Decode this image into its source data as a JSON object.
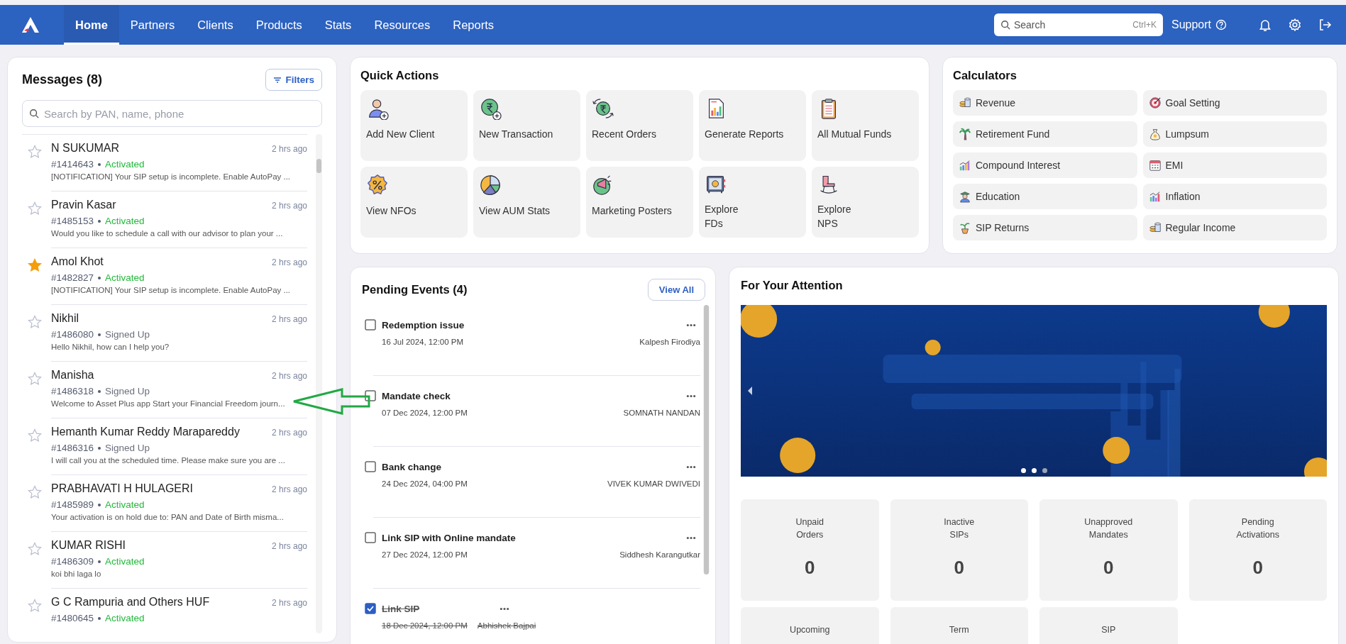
{
  "nav": {
    "tabs": [
      {
        "label": "Home",
        "selected": true
      },
      {
        "label": "Partners",
        "selected": false
      },
      {
        "label": "Clients",
        "selected": false
      },
      {
        "label": "Products",
        "selected": false
      },
      {
        "label": "Stats",
        "selected": false
      },
      {
        "label": "Resources",
        "selected": false
      },
      {
        "label": "Reports",
        "selected": false
      }
    ],
    "search": {
      "placeholder": "Search",
      "shortcut": "Ctrl+K"
    },
    "support": "Support"
  },
  "messages": {
    "title": "Messages (8)",
    "filters": "Filters",
    "search_placeholder": "Search by PAN, name, phone",
    "items": [
      {
        "name": "N SUKUMAR",
        "id": "#1414643",
        "status": {
          "text": "Activated",
          "color": "#22b83a"
        },
        "time": "2 hrs ago",
        "preview": "[NOTIFICATION] Your SIP setup is incomplete. Enable AutoPay ...",
        "starred": false
      },
      {
        "name": "Pravin Kasar",
        "id": "#1485153",
        "status": {
          "text": "Activated",
          "color": "#22b83a"
        },
        "time": "2 hrs ago",
        "preview": "Would you like to schedule a call with our advisor to plan your ...",
        "starred": false
      },
      {
        "name": "Amol Khot",
        "id": "#1482827",
        "status": {
          "text": "Activated",
          "color": "#22b83a"
        },
        "time": "2 hrs ago",
        "preview": "[NOTIFICATION] Your SIP setup is incomplete. Enable AutoPay ...",
        "starred": true
      },
      {
        "name": "Nikhil",
        "id": "#1486080",
        "status": {
          "text": "Signed Up",
          "color": "#6b6f7a"
        },
        "time": "2 hrs ago",
        "preview": "Hello Nikhil, how can I help you?",
        "starred": false
      },
      {
        "name": "Manisha",
        "id": "#1486318",
        "status": {
          "text": "Signed Up",
          "color": "#6b6f7a"
        },
        "time": "2 hrs ago",
        "preview": "Welcome to Asset Plus app Start your Financial Freedom journ...",
        "starred": false
      },
      {
        "name": "Hemanth Kumar Reddy Marapareddy",
        "id": "#1486316",
        "status": {
          "text": "Signed Up",
          "color": "#6b6f7a"
        },
        "time": "2 hrs ago",
        "preview": "I will call you at the scheduled time. Please make sure you are ...",
        "starred": false
      },
      {
        "name": "PRABHAVATI H HULAGERI",
        "id": "#1485989",
        "status": {
          "text": "Activated",
          "color": "#22b83a"
        },
        "time": "2 hrs ago",
        "preview": "Your activation is on hold due to: PAN and Date of Birth misma...",
        "starred": false
      },
      {
        "name": "KUMAR RISHI",
        "id": "#1486309",
        "status": {
          "text": "Activated",
          "color": "#22b83a"
        },
        "time": "2 hrs ago",
        "preview": "koi bhi laga lo",
        "starred": false
      },
      {
        "name": "G C Rampuria and Others HUF",
        "id": "#1480645",
        "status": {
          "text": "Activated",
          "color": "#22b83a"
        },
        "time": "2 hrs ago",
        "starred": false
      }
    ]
  },
  "quick_actions": {
    "title": "Quick Actions",
    "items": [
      {
        "label_lines": [
          "Add New Client"
        ]
      },
      {
        "label_lines": [
          "New Transaction"
        ]
      },
      {
        "label_lines": [
          "Recent Orders"
        ]
      },
      {
        "label_lines": [
          "Generate Reports"
        ]
      },
      {
        "label_lines": [
          "All Mutual Funds"
        ]
      },
      {
        "label_lines": [
          "View NFOs"
        ]
      },
      {
        "label_lines": [
          "View AUM Stats"
        ]
      },
      {
        "label_lines": [
          "Marketing Posters"
        ]
      },
      {
        "label_lines": [
          "Explore",
          "FDs"
        ]
      },
      {
        "label_lines": [
          "Explore",
          "NPS"
        ]
      }
    ]
  },
  "calculators": {
    "title": "Calculators",
    "items": [
      "Revenue",
      "Goal Setting",
      "Retirement Fund",
      "Lumpsum",
      "Compound Interest",
      "EMI",
      "Education",
      "Inflation",
      "SIP Returns",
      "Regular Income"
    ]
  },
  "pending_events": {
    "title": "Pending Events (4)",
    "view_all": "View All",
    "items": [
      {
        "title": "Redemption issue",
        "date": "16 Jul 2024, 12:00 PM",
        "owner": "Kalpesh Firodiya",
        "checked": false
      },
      {
        "title": "Mandate check",
        "date": "07 Dec 2024, 12:00 PM",
        "owner": "SOMNATH NANDAN",
        "checked": false
      },
      {
        "title": "Bank change",
        "date": "24 Dec 2024, 04:00 PM",
        "owner": "VIVEK KUMAR DWIVEDI",
        "checked": false
      },
      {
        "title": "Link SIP with Online mandate",
        "date": "27 Dec 2024, 12:00 PM",
        "owner": "Siddhesh Karangutkar",
        "checked": false
      },
      {
        "title": "Link SIP",
        "date": "18 Dec 2024, 12:00 PM",
        "owner": "Abhishek Bajpai",
        "checked": true
      }
    ]
  },
  "attention": {
    "title": "For Your Attention",
    "banner": {
      "kind": "picture",
      "slides": [
        {
          "selected": false
        },
        {
          "selected": false
        },
        {
          "selected": true
        }
      ]
    },
    "tiles": [
      {
        "label_lines": [
          "Unpaid",
          "Orders"
        ],
        "value": "0"
      },
      {
        "label_lines": [
          "Inactive",
          "SIPs"
        ],
        "value": "0"
      },
      {
        "label_lines": [
          "Unapproved",
          "Mandates"
        ],
        "value": "0"
      },
      {
        "label_lines": [
          "Pending",
          "Activations"
        ],
        "value": "0"
      },
      {
        "label_lines": [
          "Upcoming"
        ]
      },
      {
        "label_lines": [
          "Term"
        ]
      },
      {
        "label_lines": [
          "SIP"
        ]
      }
    ]
  }
}
